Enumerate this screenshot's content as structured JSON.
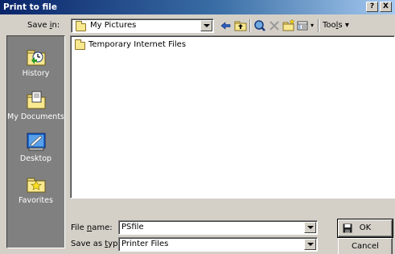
{
  "window": {
    "title": "Print to file",
    "help_button": "?",
    "close_button": "X"
  },
  "toolbar": {
    "save_in_label_pre": "Save ",
    "save_in_label_key": "i",
    "save_in_label_post": "n:",
    "location_value": "My Pictures",
    "tools_label_pre": "Too",
    "tools_label_key": "l",
    "tools_label_post": "s",
    "tools_arrow": "▾",
    "views_arrow": "▾",
    "icons": [
      "back-arrow-icon",
      "up-folder-icon",
      "search-web-icon",
      "delete-icon",
      "new-folder-icon",
      "views-icon"
    ]
  },
  "places": [
    {
      "label": "History",
      "icon": "history-icon"
    },
    {
      "label": "My Documents",
      "icon": "my-documents-icon"
    },
    {
      "label": "Desktop",
      "icon": "desktop-icon"
    },
    {
      "label": "Favorites",
      "icon": "favorites-icon"
    }
  ],
  "files": [
    {
      "name": "Temporary Internet Files",
      "type": "folder"
    }
  ],
  "form": {
    "file_name_label_pre": "File ",
    "file_name_label_key": "n",
    "file_name_label_post": "ame:",
    "file_name_value": "PSfile",
    "save_type_label_pre": "Save as ",
    "save_type_label_key": "t",
    "save_type_label_post": "ype:",
    "save_type_value": "Printer Files"
  },
  "buttons": {
    "ok": "OK",
    "cancel": "Cancel"
  },
  "colors": {
    "titlebar_start": "#0a246a",
    "titlebar_end": "#a6caf0",
    "dialog_face": "#d4d0c8",
    "places_bar": "#808080"
  }
}
